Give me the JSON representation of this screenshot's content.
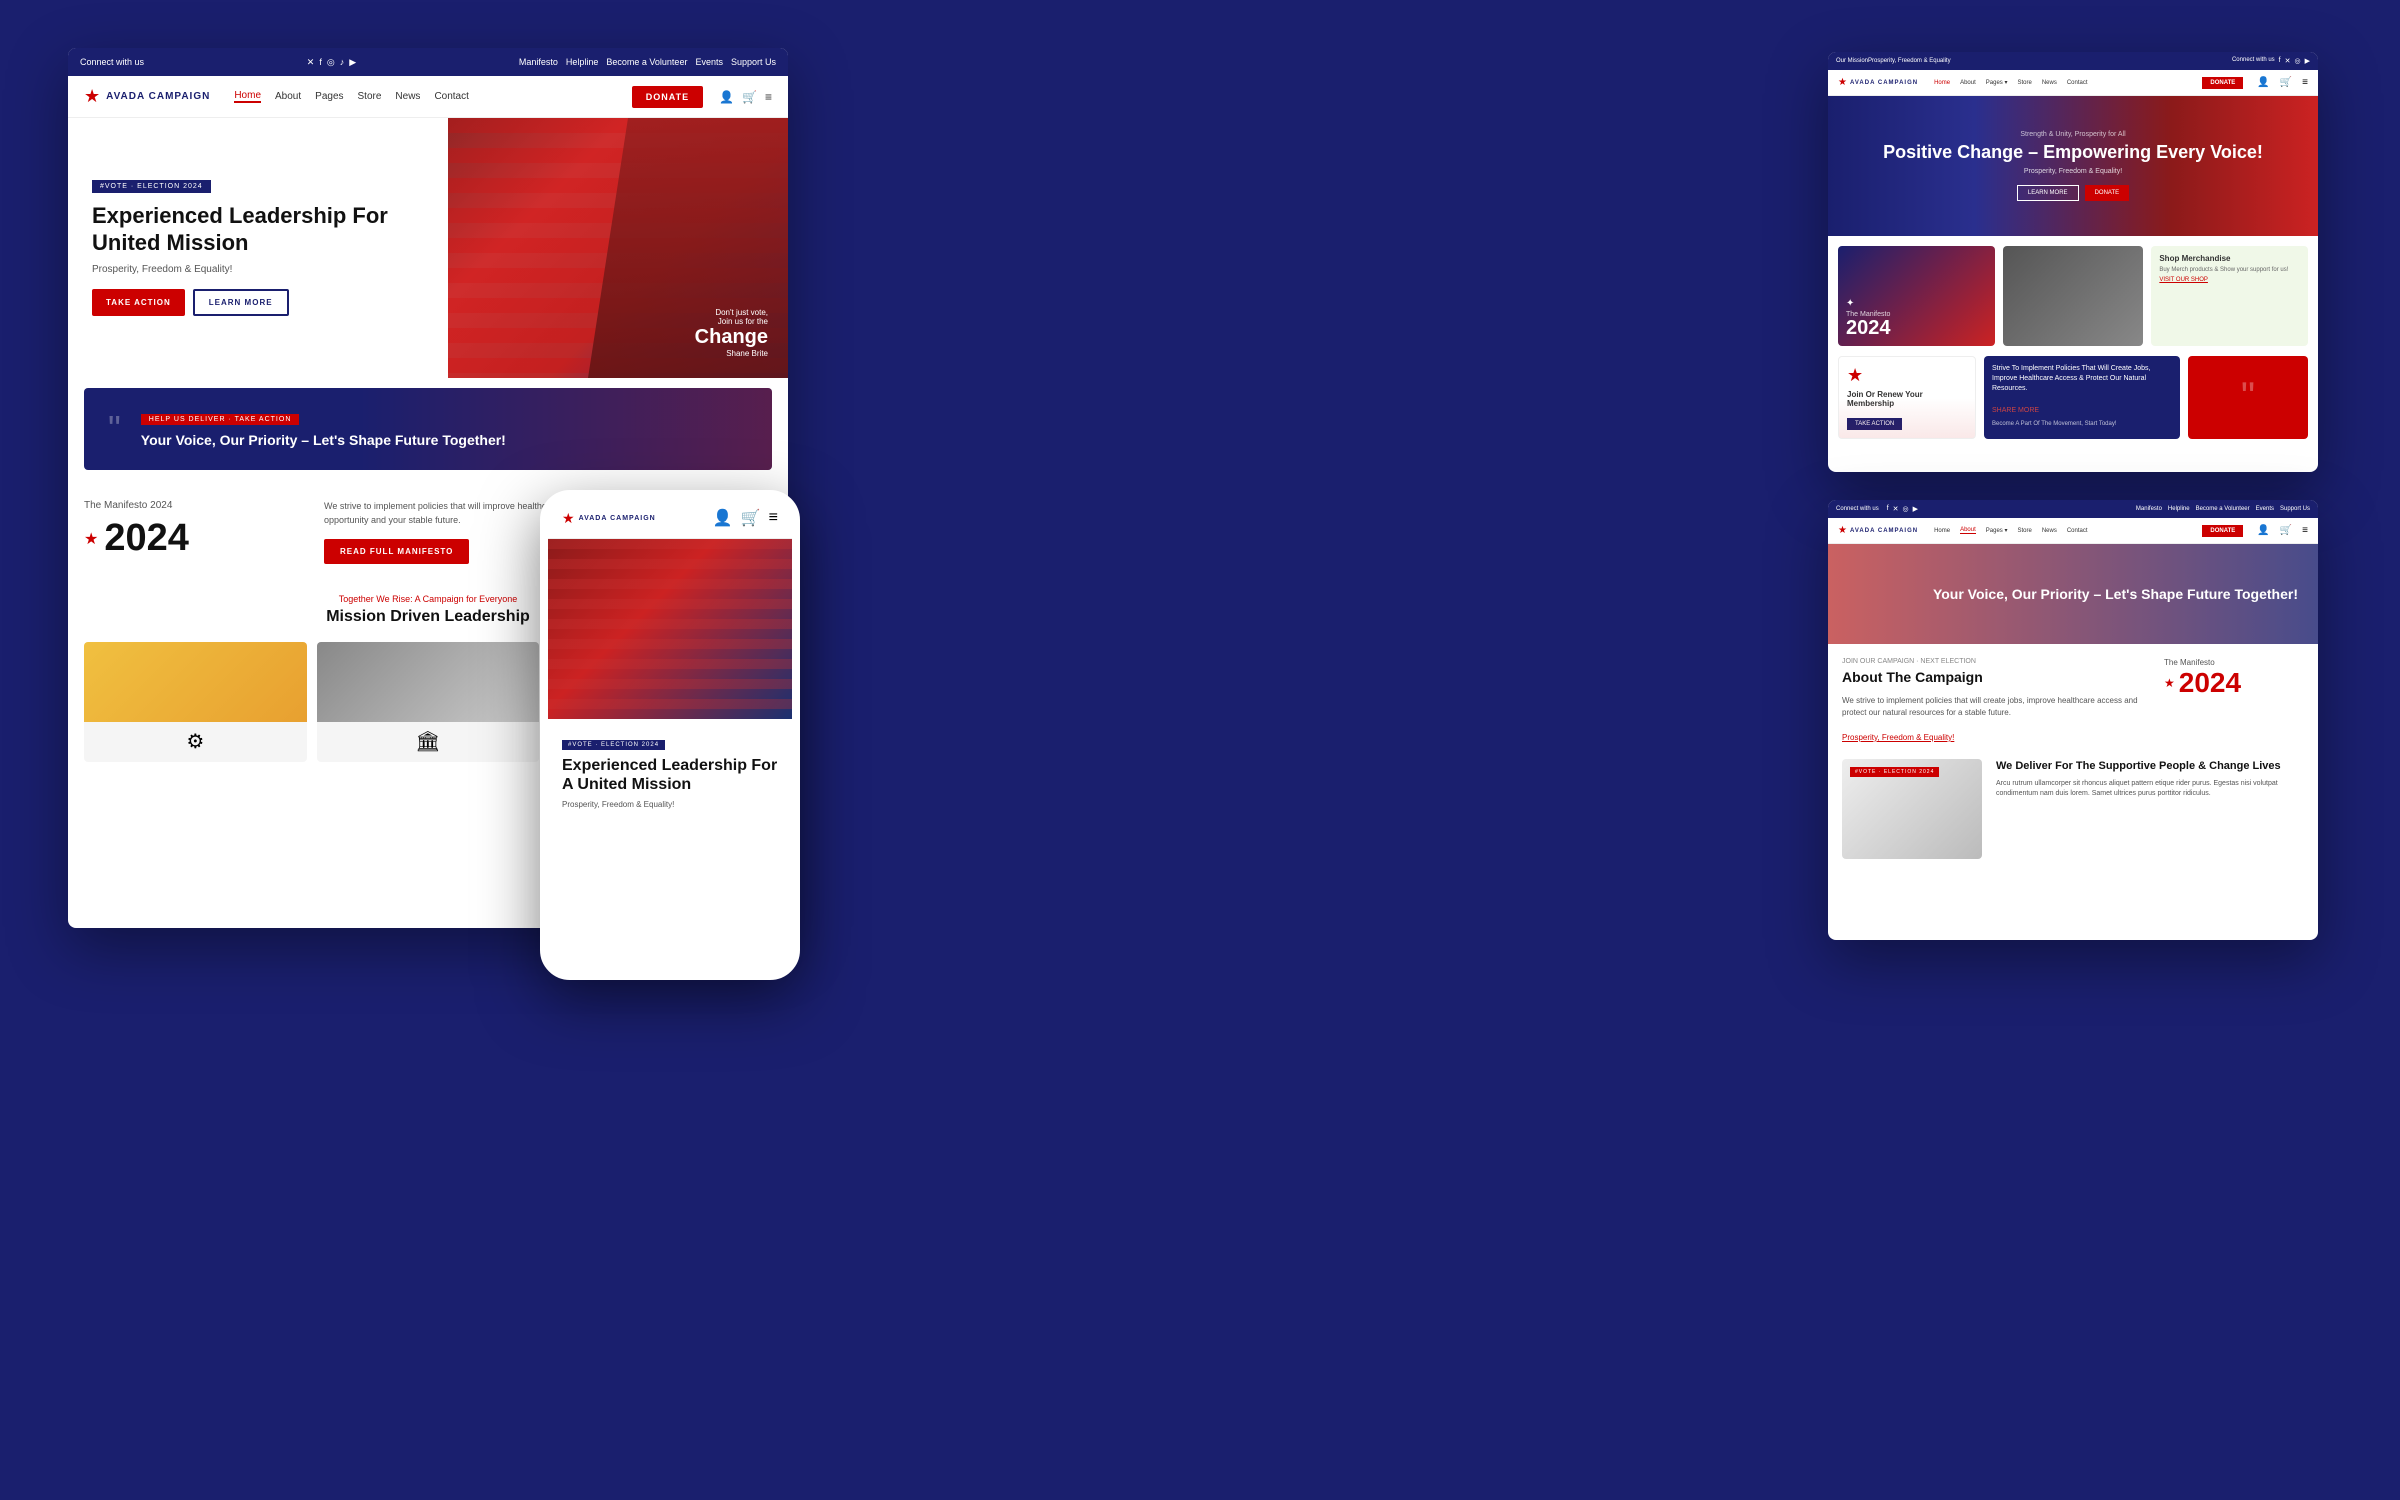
{
  "page": {
    "background_color": "#1a1f6e"
  },
  "mockup_main": {
    "topbar": {
      "connect_text": "Connect with us",
      "nav_items": [
        "Manifesto",
        "Helpline",
        "Become a Volunteer",
        "Events",
        "Support Us"
      ]
    },
    "nav": {
      "logo_text": "AVADA CAMPAIGN",
      "links": [
        "Home",
        "About",
        "Pages",
        "Store",
        "News",
        "Contact"
      ],
      "active_link": "Home",
      "donate_label": "DONATE"
    },
    "hero": {
      "badge": "#VOTE · ELECTION 2024",
      "title": "Experienced Leadership For United Mission",
      "subtitle": "Prosperity, Freedom & Equality!",
      "btn_primary": "TAKE ACTION",
      "btn_secondary": "LEARN MORE",
      "overlay_small": "Don't just vote,",
      "overlay_medium": "Join us for the",
      "overlay_big": "Change",
      "overlay_name": "Shane Brite"
    },
    "quote_banner": {
      "label": "HELP US DELIVER · TAKE ACTION",
      "text": "Your Voice, Our Priority – Let's Shape Future Together!"
    },
    "manifesto": {
      "label": "The Manifesto 2024",
      "year": "2024",
      "text": "We strive to implement policies that will improve healthcare access and protect our resources. Vote for an equal opportunity and your stable future.",
      "btn_label": "READ FULL MANIFESTO"
    },
    "mission": {
      "label": "Together We Rise: A Campaign for Everyone",
      "title": "Mission Driven Leadership"
    }
  },
  "mockup_phone": {
    "nav": {
      "logo_text": "AVADA CAMPAIGN"
    },
    "hero": {
      "badge": "#VOTE · ELECTION 2024",
      "title": "Experienced Leadership For A United Mission",
      "subtitle": "Prosperity, Freedom & Equality!"
    }
  },
  "mockup_desktop_tr": {
    "topbar": {
      "our_mission": "Our Mission",
      "prosperity": "Prosperity, Freedom & Equality"
    },
    "nav": {
      "logo_text": "AVADA CAMPAIGN",
      "links": [
        "Home",
        "About",
        "Pages",
        "Store",
        "News",
        "Contact"
      ],
      "active": "Home",
      "donate_label": "DONATE"
    },
    "hero": {
      "sub": "Strength & Unity, Prosperity for All",
      "title": "Positive Change – Empowering Every Voice!",
      "tagline": "Prosperity, Freedom & Equality!",
      "btn_learn": "LEARN MORE",
      "btn_donate": "DONATE"
    },
    "cards": {
      "manifesto_label": "The Manifesto",
      "manifesto_year": "2024",
      "merch_title": "Shop Merchandise",
      "merch_text": "Buy Merch products & Show your support for us!",
      "merch_link": "VISIT OUR SHOP"
    },
    "cards2": {
      "membership_icon": "★",
      "membership_title": "Join Or Renew Your Membership",
      "membership_btn": "TAKE ACTION",
      "policies_text": "Strive To Implement Policies That Will Create Jobs, Improve Healthcare Access & Protect Our Natural Resources.",
      "policies_link": "SHARE MORE",
      "policies_sub": "Become A Part Of The Movement, Start Today!",
      "quote_icon": "“”"
    }
  },
  "mockup_desktop_br": {
    "topbar": {
      "connect": "Connect with us"
    },
    "nav": {
      "logo_text": "AVADA CAMPAIGN",
      "links": [
        "Home",
        "About",
        "Pages",
        "Store",
        "News",
        "Contact"
      ],
      "active": "About",
      "donate_label": "DONATE"
    },
    "hero": {
      "title": "Your Voice, Our Priority – Let's Shape Future Together!"
    },
    "content": {
      "label": "JOIN OUR CAMPAIGN · NEXT ELECTION",
      "title": "About The Campaign",
      "text": "We strive to implement policies that will create jobs, improve healthcare access and protect our natural resources for a stable future.",
      "link": "Prosperity, Freedom & Equality!",
      "manifesto_label": "The Manifesto",
      "manifesto_year": "2024"
    },
    "bottom": {
      "badge": "#VOTE · ELECTION 2024",
      "title": "We Deliver For The Supportive People & Change Lives",
      "text": "Arcu rutrum ullamcorper sit rhoncus aliquet pattern etique rider purus. Egestas nisi volutpat condimentum nam duis lorem. Samet ultrices purus porttitor ridiculus."
    }
  }
}
